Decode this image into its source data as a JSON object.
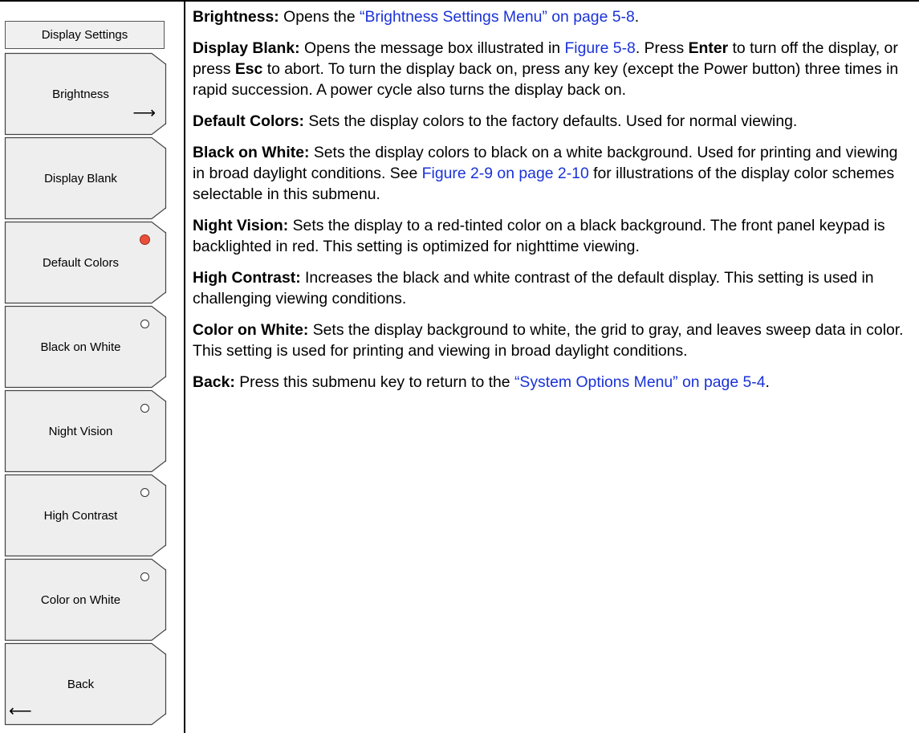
{
  "menu": {
    "title": "Display Settings",
    "keys": [
      {
        "label": "Brightness"
      },
      {
        "label": "Display Blank"
      },
      {
        "label": "Default Colors"
      },
      {
        "label": "Black on White"
      },
      {
        "label": "Night Vision"
      },
      {
        "label": "High Contrast"
      },
      {
        "label": "Color on White"
      },
      {
        "label": "Back"
      }
    ],
    "right_arrow": "⟶",
    "left_arrow": "⟵"
  },
  "colors": {
    "radio_selected": "#e8503a",
    "link": "#1a32d8"
  },
  "descriptions": {
    "brightness": {
      "term": "Brightness:",
      "t1": "Opens the ",
      "link1": "“Brightness Settings Menu” on page 5-8",
      "t2": "."
    },
    "display_blank": {
      "term": "Display Blank:",
      "t1": "Opens the message box illustrated in ",
      "link1": "Figure 5-8",
      "t2": ". Press ",
      "b1": "Enter",
      "t3": " to turn off the display, or press ",
      "b2": "Esc",
      "t4": " to abort. To turn the display back on, press any key (except the Power button) three times in rapid succession. A power cycle also turns the display back on."
    },
    "default_colors": {
      "term": "Default Colors:",
      "t1": "Sets the display colors to the factory defaults. Used for normal viewing."
    },
    "black_on_white": {
      "term": "Black on White:",
      "t1": "Sets the display colors to black on a white background. Used for printing and viewing in broad daylight conditions. See ",
      "link1": "Figure 2-9 on page 2-10",
      "t2": " for illustrations of the display color schemes selectable in this submenu."
    },
    "night_vision": {
      "term": "Night Vision:",
      "t1": "Sets the display to a red-tinted color on a black background. The front panel keypad is backlighted in red. This setting is optimized for nighttime viewing."
    },
    "high_contrast": {
      "term": "High Contrast:",
      "t1": "Increases the black and white contrast of the default display. This setting is used in challenging viewing conditions."
    },
    "color_on_white": {
      "term": "Color on White:",
      "t1": "Sets the display background to white, the grid to gray, and leaves sweep data in color. This setting is used for printing and viewing in broad daylight conditions."
    },
    "back": {
      "term": "Back:",
      "t1": "Press this submenu key to return to the ",
      "link1": "“System Options Menu” on page 5-4",
      "t2": "."
    }
  }
}
